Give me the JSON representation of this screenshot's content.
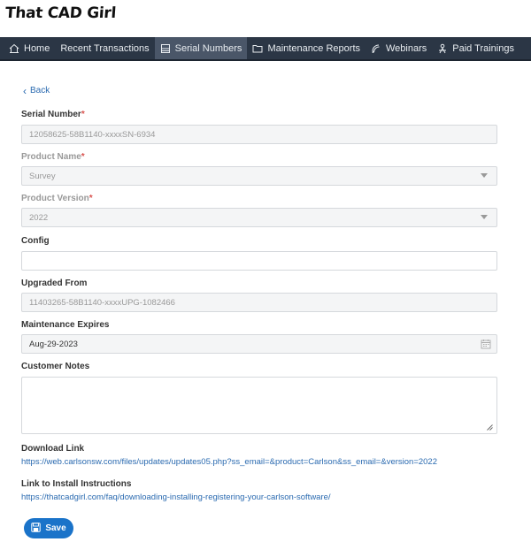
{
  "brand": {
    "logo_text": "That CAD Girl"
  },
  "nav": {
    "items": [
      {
        "label": "Home",
        "icon": "home-icon"
      },
      {
        "label": "Recent Transactions",
        "icon": ""
      },
      {
        "label": "Serial Numbers",
        "icon": "serial-icon",
        "active": true
      },
      {
        "label": "Maintenance Reports",
        "icon": "folder-icon"
      },
      {
        "label": "Webinars",
        "icon": "webinar-icon"
      },
      {
        "label": "Paid Trainings",
        "icon": "training-icon"
      }
    ]
  },
  "back_label": "Back",
  "form": {
    "serial_number": {
      "label": "Serial Number",
      "value": "12058625-58B1140-xxxxSN-6934"
    },
    "product_name": {
      "label": "Product Name",
      "value": "Survey"
    },
    "product_version": {
      "label": "Product Version",
      "value": "2022"
    },
    "config": {
      "label": "Config",
      "value": ""
    },
    "upgraded_from": {
      "label": "Upgraded From",
      "value": "11403265-58B1140-xxxxUPG-1082466"
    },
    "maintenance_expires": {
      "label": "Maintenance Expires",
      "value": "Aug-29-2023"
    },
    "customer_notes": {
      "label": "Customer Notes",
      "value": ""
    },
    "download_link": {
      "label": "Download Link",
      "url": "https://web.carlsonsw.com/files/updates/updates05.php?ss_email=&product=Carlson&ss_email=&version=2022"
    },
    "install_link": {
      "label": "Link to Install Instructions",
      "url": "https://thatcadgirl.com/faq/downloading-installing-registering-your-carlson-software/"
    },
    "required_mark": "*"
  },
  "save_label": "Save",
  "colors": {
    "nav_bg": "#2b3645",
    "nav_active": "#4a5668",
    "link": "#2a6ab0",
    "primary": "#1a73c9",
    "required": "#d9534f"
  }
}
